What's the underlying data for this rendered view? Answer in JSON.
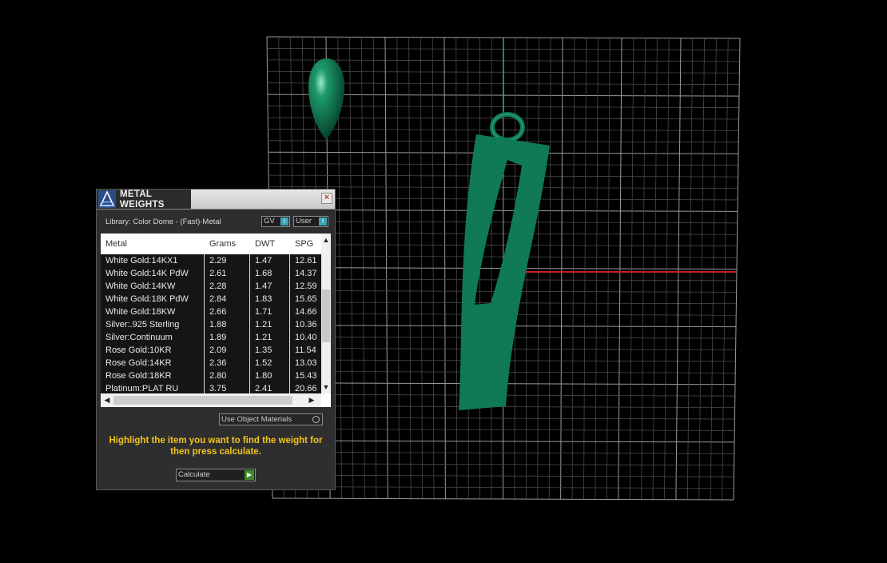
{
  "panel": {
    "title": "METAL WEIGHTS",
    "close_glyph": "×",
    "library": "Library: Color Dome - (Fast)-Metal",
    "toggle_gv": "GV",
    "toggle_user": "User",
    "toggle_knob": "I",
    "use_object_materials": "Use Object Materials",
    "hint": "Highlight the item you want to find the weight for then press calculate.",
    "calculate": "Calculate",
    "calculate_icon": "play-arrow",
    "columns": [
      "Metal",
      "Grams",
      "DWT",
      "SPG"
    ],
    "rows": [
      {
        "metal": "White Gold:14KX1",
        "grams": "2.29",
        "dwt": "1.47",
        "spg": "12.61"
      },
      {
        "metal": "White Gold:14K PdW",
        "grams": "2.61",
        "dwt": "1.68",
        "spg": "14.37"
      },
      {
        "metal": "White Gold:14KW",
        "grams": "2.28",
        "dwt": "1.47",
        "spg": "12.59"
      },
      {
        "metal": "White Gold:18K PdW",
        "grams": "2.84",
        "dwt": "1.83",
        "spg": "15.65"
      },
      {
        "metal": "White Gold:18KW",
        "grams": "2.66",
        "dwt": "1.71",
        "spg": "14.66"
      },
      {
        "metal": "Silver:.925 Sterling",
        "grams": "1.88",
        "dwt": "1.21",
        "spg": "10.36"
      },
      {
        "metal": "Silver:Continuum",
        "grams": "1.89",
        "dwt": "1.21",
        "spg": "10.40"
      },
      {
        "metal": "Rose Gold:10KR",
        "grams": "2.09",
        "dwt": "1.35",
        "spg": "11.54"
      },
      {
        "metal": "Rose Gold:14KR",
        "grams": "2.36",
        "dwt": "1.52",
        "spg": "13.03"
      },
      {
        "metal": "Rose Gold:18KR",
        "grams": "2.80",
        "dwt": "1.80",
        "spg": "15.43"
      },
      {
        "metal": "Platinum:PLAT RU",
        "grams": "3.75",
        "dwt": "2.41",
        "spg": "20.66"
      }
    ]
  },
  "colors": {
    "model_green": "#0f7a55",
    "hint_yellow": "#f0c41e",
    "axis_red": "#c81e1e",
    "axis_cyan": "#2fa6b4"
  }
}
